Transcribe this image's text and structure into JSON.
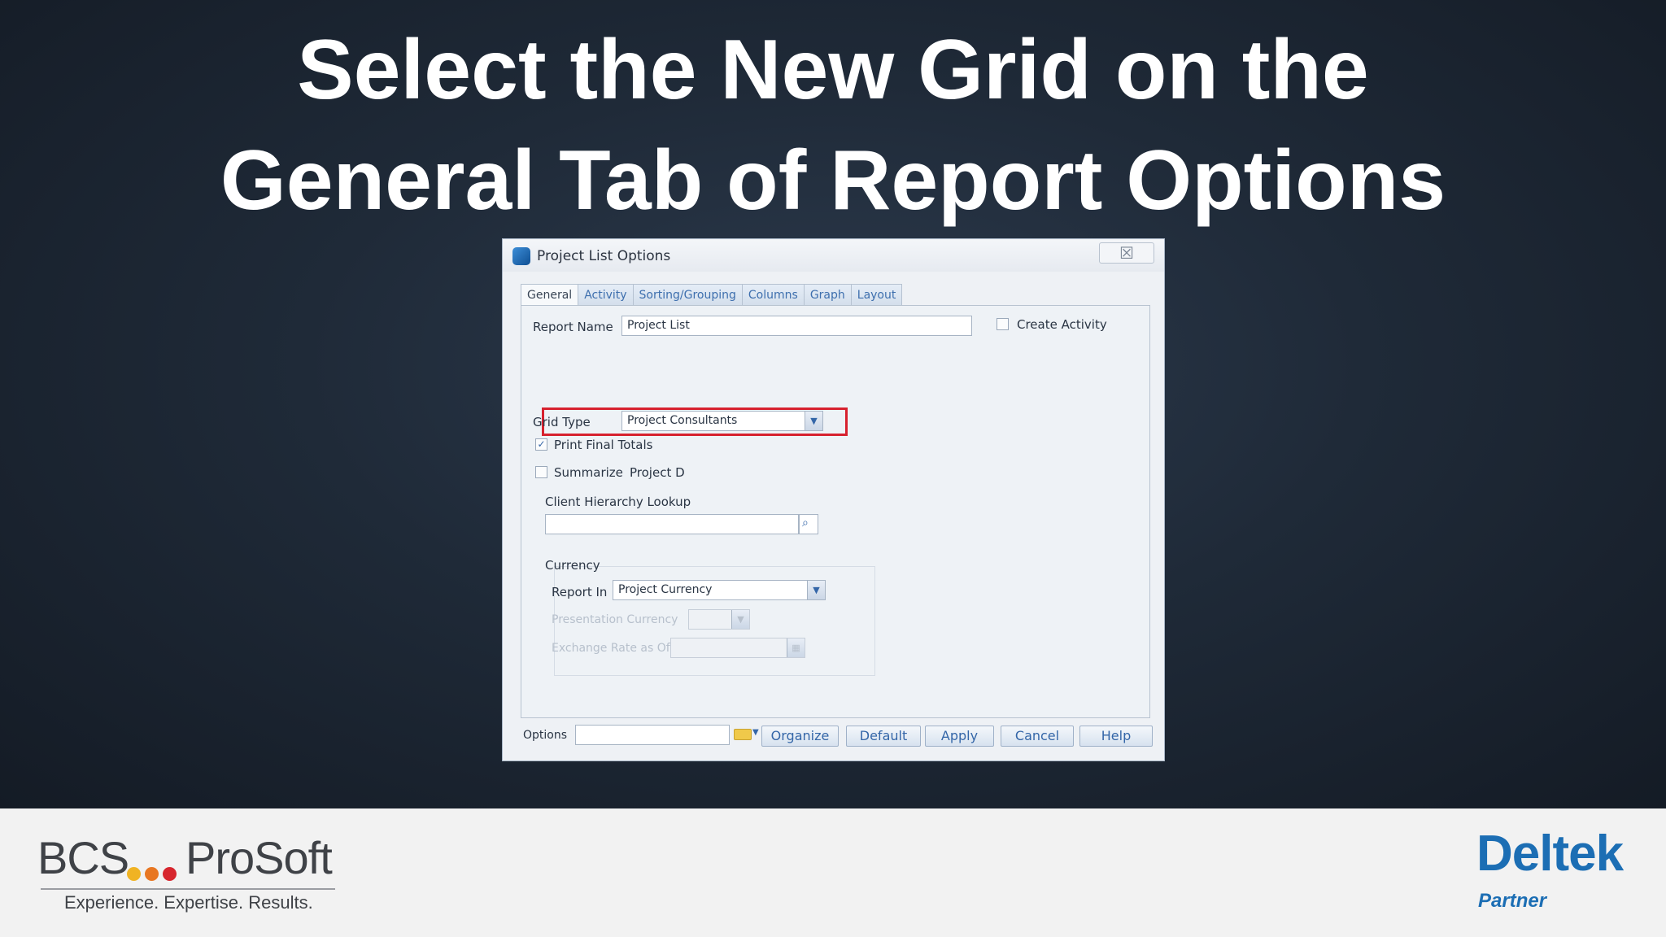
{
  "slide": {
    "title_line1": "Select the New Grid on the",
    "title_line2": "General Tab of Report Options"
  },
  "dialog": {
    "title": "Project List Options",
    "close_glyph": "☒",
    "tabs": [
      "General",
      "Activity",
      "Sorting/Grouping",
      "Columns",
      "Graph",
      "Layout"
    ],
    "report_name_label": "Report Name",
    "report_name_value": "Project List",
    "create_activity_label": "Create Activity",
    "grid_type_label": "Grid Type",
    "grid_type_value": "Project Consultants",
    "print_final_totals_label": "Print Final Totals",
    "print_final_totals_checked": true,
    "summarize_label": "Summarize",
    "summarize_value": "Project D",
    "client_hierarchy_label": "Client Hierarchy Lookup",
    "currency_group_label": "Currency",
    "report_in_label": "Report In",
    "report_in_value": "Project Currency",
    "presentation_currency_label": "Presentation Currency",
    "exchange_rate_label": "Exchange Rate as Of",
    "options_label": "Options",
    "buttons": {
      "organize": "Organize",
      "default": "Default",
      "apply": "Apply",
      "cancel": "Cancel",
      "help": "Help"
    }
  },
  "brand": {
    "bcs_left": "BCS",
    "bcs_right": "ProSoft",
    "bcs_tagline": "Experience. Expertise. Results.",
    "bcs_dot_colors": [
      "#f0b323",
      "#e87722",
      "#d7262e"
    ],
    "deltek_name": "Deltek",
    "deltek_partner": "Partner",
    "deltek_color": "#1c6eb4"
  }
}
